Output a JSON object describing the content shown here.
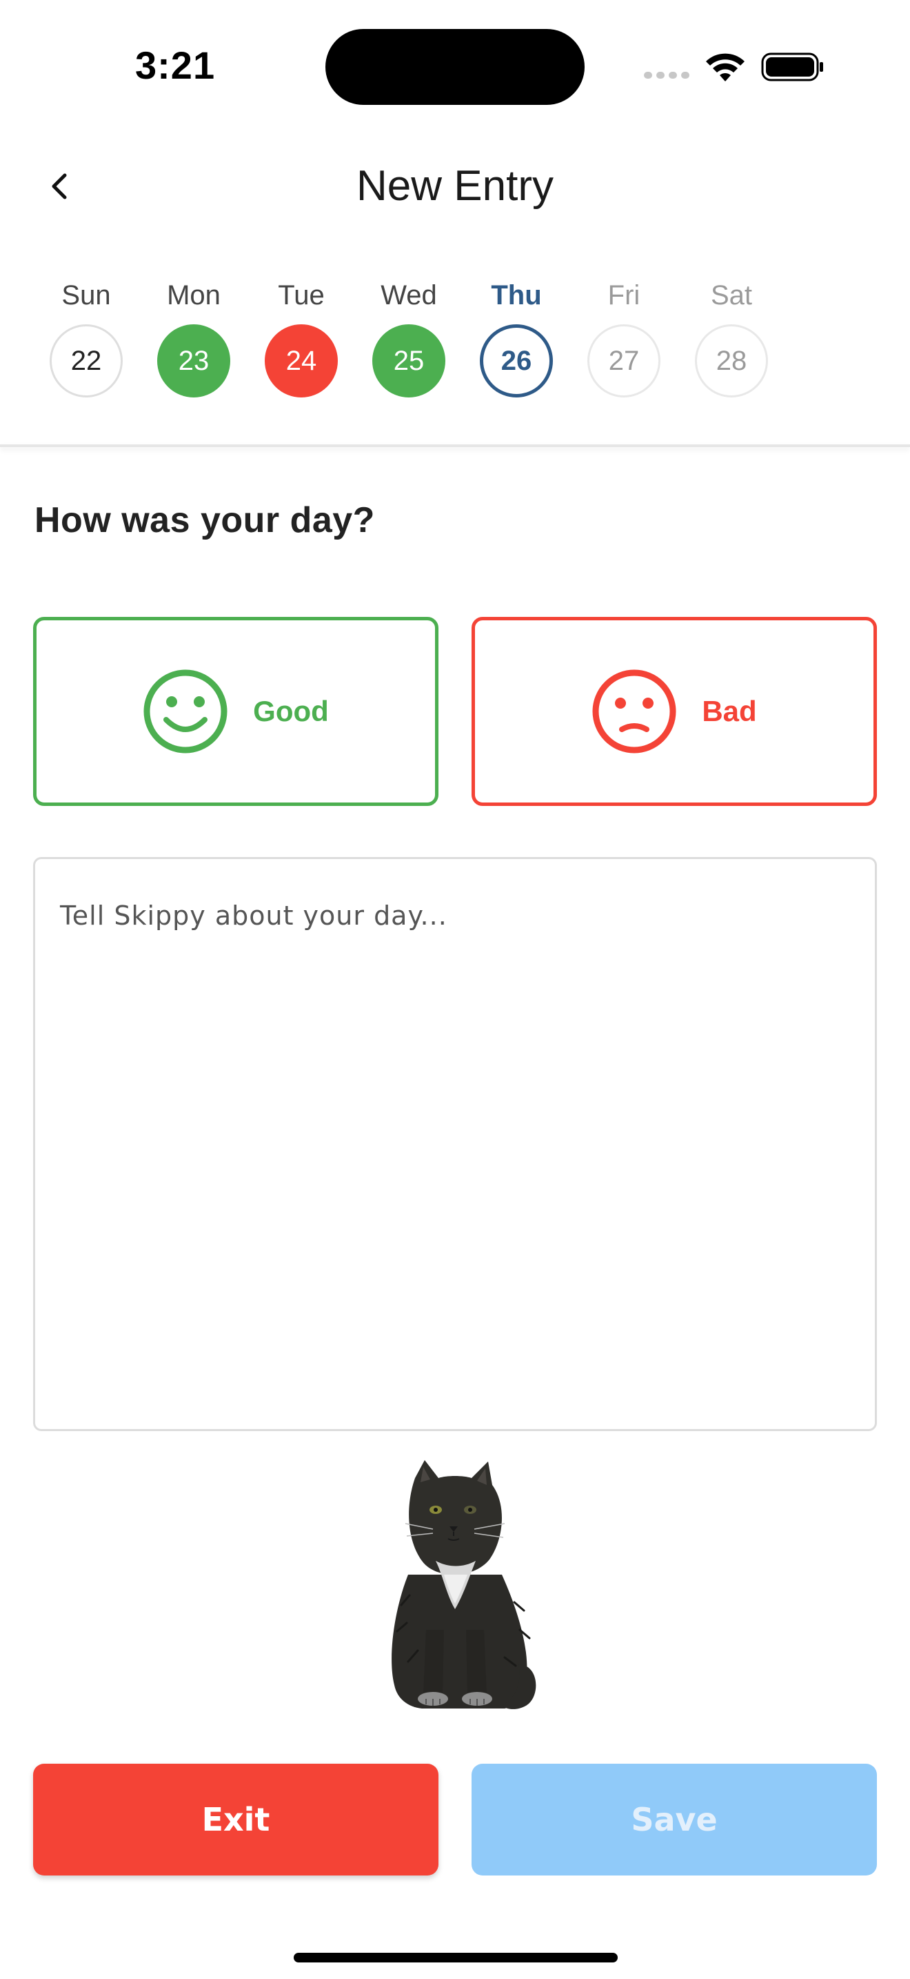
{
  "status_bar": {
    "time": "3:21"
  },
  "header": {
    "title": "New Entry"
  },
  "week": [
    {
      "name": "Sun",
      "date": "22",
      "state": "empty"
    },
    {
      "name": "Mon",
      "date": "23",
      "state": "good"
    },
    {
      "name": "Tue",
      "date": "24",
      "state": "bad"
    },
    {
      "name": "Wed",
      "date": "25",
      "state": "good"
    },
    {
      "name": "Thu",
      "date": "26",
      "state": "today"
    },
    {
      "name": "Fri",
      "date": "27",
      "state": "future"
    },
    {
      "name": "Sat",
      "date": "28",
      "state": "future"
    }
  ],
  "question": "How was your day?",
  "moods": {
    "good_label": "Good",
    "bad_label": "Bad"
  },
  "entry": {
    "value": "",
    "placeholder": "Tell Skippy about your day..."
  },
  "actions": {
    "exit_label": "Exit",
    "save_label": "Save"
  },
  "colors": {
    "good": "#4caf50",
    "bad": "#f44336",
    "today": "#2e5a88",
    "save_disabled": "#90caf9"
  }
}
